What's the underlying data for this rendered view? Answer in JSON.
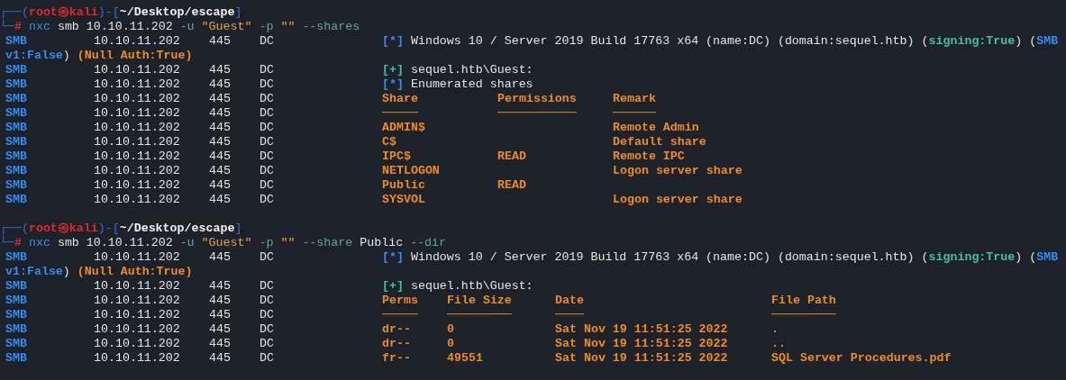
{
  "blocks": [
    {
      "prompt": {
        "corner_top": "┌──(",
        "user": "root",
        "at": "㉿",
        "host": "kali",
        "mid": ")-[",
        "path": "~/Desktop/escape",
        "end": "]",
        "corner_bottom": "└─",
        "symbol": "#"
      },
      "command": [
        {
          "text": "nxc",
          "kind": "exec"
        },
        {
          "text": "smb",
          "kind": "arg"
        },
        {
          "text": "10.10.11.202",
          "kind": "arg"
        },
        {
          "text": "-u",
          "kind": "flag"
        },
        {
          "text": "\"Guest\"",
          "kind": "string"
        },
        {
          "text": "-p",
          "kind": "flag"
        },
        {
          "text": "\"\"",
          "kind": "string"
        },
        {
          "text": "--shares",
          "kind": "flag"
        }
      ],
      "lines": [
        {
          "kind": "smb",
          "prefix": [
            "SMB",
            "10.10.11.202",
            "445",
            "DC"
          ],
          "segments": [
            {
              "text": "[*]",
              "kind": "info"
            },
            {
              "text": "Windows 10 / Server 2019 Build 17763 x64 (name:DC) (domain:sequel.htb)",
              "kind": "plain"
            },
            {
              "kind": "group",
              "parts": [
                {
                  "text": "(",
                  "kind": "plain"
                },
                {
                  "text": "signing:True",
                  "kind": "good"
                },
                {
                  "text": ")",
                  "kind": "plain"
                }
              ]
            },
            {
              "kind": "group",
              "parts": [
                {
                  "text": "(",
                  "kind": "plain"
                },
                {
                  "text": "SMB",
                  "kind": "proto"
                }
              ]
            }
          ]
        },
        {
          "kind": "wrap",
          "segments": [
            {
              "kind": "group",
              "parts": [
                {
                  "text": "v1:False",
                  "kind": "proto"
                },
                {
                  "text": ")",
                  "kind": "plain"
                }
              ]
            },
            {
              "text": "(Null Auth:True)",
              "kind": "warn"
            }
          ]
        },
        {
          "kind": "smb",
          "prefix": [
            "SMB",
            "10.10.11.202",
            "445",
            "DC"
          ],
          "segments": [
            {
              "text": "[+]",
              "kind": "plus"
            },
            {
              "text": "sequel.htb\\Guest:",
              "kind": "plain"
            }
          ]
        },
        {
          "kind": "smb",
          "prefix": [
            "SMB",
            "10.10.11.202",
            "445",
            "DC"
          ],
          "segments": [
            {
              "text": "[*]",
              "kind": "info"
            },
            {
              "text": "Enumerated shares",
              "kind": "plain"
            }
          ]
        },
        {
          "kind": "shares_table",
          "prefix": [
            "SMB",
            "10.10.11.202",
            "445",
            "DC"
          ],
          "cells": [
            "Share",
            "Permissions",
            "Remark"
          ]
        },
        {
          "kind": "shares_table",
          "prefix": [
            "SMB",
            "10.10.11.202",
            "445",
            "DC"
          ],
          "cells": [
            "─────",
            "───────────",
            "──────"
          ]
        },
        {
          "kind": "shares_table",
          "prefix": [
            "SMB",
            "10.10.11.202",
            "445",
            "DC"
          ],
          "cells": [
            "ADMIN$",
            null,
            "Remote Admin"
          ]
        },
        {
          "kind": "shares_table",
          "prefix": [
            "SMB",
            "10.10.11.202",
            "445",
            "DC"
          ],
          "cells": [
            "C$",
            null,
            "Default share"
          ]
        },
        {
          "kind": "shares_table",
          "prefix": [
            "SMB",
            "10.10.11.202",
            "445",
            "DC"
          ],
          "cells": [
            "IPC$",
            "READ",
            "Remote IPC"
          ]
        },
        {
          "kind": "shares_table",
          "prefix": [
            "SMB",
            "10.10.11.202",
            "445",
            "DC"
          ],
          "cells": [
            "NETLOGON",
            null,
            "Logon server share"
          ]
        },
        {
          "kind": "shares_table",
          "prefix": [
            "SMB",
            "10.10.11.202",
            "445",
            "DC"
          ],
          "cells": [
            "Public",
            "READ",
            null
          ]
        },
        {
          "kind": "shares_table",
          "prefix": [
            "SMB",
            "10.10.11.202",
            "445",
            "DC"
          ],
          "cells": [
            "SYSVOL",
            null,
            "Logon server share"
          ]
        }
      ]
    },
    {
      "prompt": {
        "corner_top": "┌──(",
        "user": "root",
        "at": "㉿",
        "host": "kali",
        "mid": ")-[",
        "path": "~/Desktop/escape",
        "end": "]",
        "corner_bottom": "└─",
        "symbol": "#"
      },
      "command": [
        {
          "text": "nxc",
          "kind": "exec"
        },
        {
          "text": "smb",
          "kind": "arg"
        },
        {
          "text": "10.10.11.202",
          "kind": "arg"
        },
        {
          "text": "-u",
          "kind": "flag"
        },
        {
          "text": "\"Guest\"",
          "kind": "string"
        },
        {
          "text": "-p",
          "kind": "flag"
        },
        {
          "text": "\"\"",
          "kind": "string"
        },
        {
          "text": "--share",
          "kind": "flag"
        },
        {
          "text": "Public",
          "kind": "arg"
        },
        {
          "text": "--dir",
          "kind": "flag"
        }
      ],
      "lines": [
        {
          "kind": "smb",
          "prefix": [
            "SMB",
            "10.10.11.202",
            "445",
            "DC"
          ],
          "segments": [
            {
              "text": "[*]",
              "kind": "info"
            },
            {
              "text": "Windows 10 / Server 2019 Build 17763 x64 (name:DC) (domain:sequel.htb)",
              "kind": "plain"
            },
            {
              "kind": "group",
              "parts": [
                {
                  "text": "(",
                  "kind": "plain"
                },
                {
                  "text": "signing:True",
                  "kind": "good"
                },
                {
                  "text": ")",
                  "kind": "plain"
                }
              ]
            },
            {
              "kind": "group",
              "parts": [
                {
                  "text": "(",
                  "kind": "plain"
                },
                {
                  "text": "SMB",
                  "kind": "proto"
                }
              ]
            }
          ]
        },
        {
          "kind": "wrap",
          "segments": [
            {
              "kind": "group",
              "parts": [
                {
                  "text": "v1:False",
                  "kind": "proto"
                },
                {
                  "text": ")",
                  "kind": "plain"
                }
              ]
            },
            {
              "text": "(Null Auth:True)",
              "kind": "warn"
            }
          ]
        },
        {
          "kind": "smb",
          "prefix": [
            "SMB",
            "10.10.11.202",
            "445",
            "DC"
          ],
          "segments": [
            {
              "text": "[+]",
              "kind": "plus"
            },
            {
              "text": "sequel.htb\\Guest:",
              "kind": "plain"
            }
          ]
        },
        {
          "kind": "dir_table",
          "prefix": [
            "SMB",
            "10.10.11.202",
            "445",
            "DC"
          ],
          "cells": [
            "Perms",
            "File Size",
            "Date",
            "File Path"
          ]
        },
        {
          "kind": "dir_table",
          "prefix": [
            "SMB",
            "10.10.11.202",
            "445",
            "DC"
          ],
          "cells": [
            "─────",
            "─────────",
            "────",
            "─────────"
          ]
        },
        {
          "kind": "dir_table",
          "prefix": [
            "SMB",
            "10.10.11.202",
            "445",
            "DC"
          ],
          "cells": [
            "dr--",
            "0",
            "Sat Nov 19 11:51:25 2022",
            "."
          ]
        },
        {
          "kind": "dir_table",
          "prefix": [
            "SMB",
            "10.10.11.202",
            "445",
            "DC"
          ],
          "cells": [
            "dr--",
            "0",
            "Sat Nov 19 11:51:25 2022",
            ".."
          ]
        },
        {
          "kind": "dir_table",
          "prefix": [
            "SMB",
            "10.10.11.202",
            "445",
            "DC"
          ],
          "cells": [
            "fr--",
            "49551",
            "Sat Nov 19 11:51:25 2022",
            "SQL Server Procedures.pdf"
          ]
        }
      ]
    }
  ]
}
